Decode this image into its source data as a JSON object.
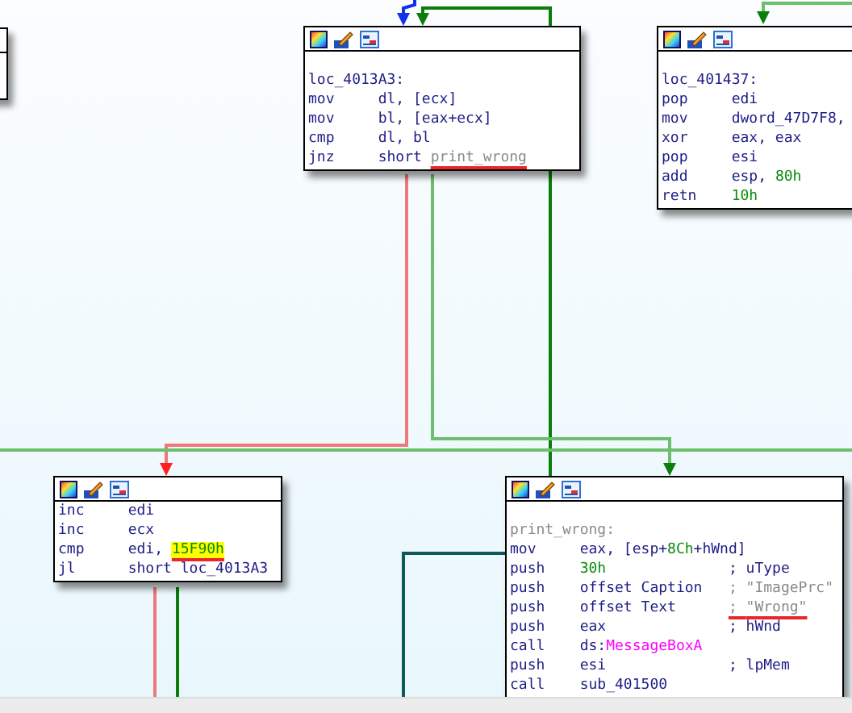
{
  "nodes": [
    {
      "lines": [
        {
          "kind": "blank"
        },
        {
          "kind": "label",
          "label": [
            {
              "text": "loc_4013A3:",
              "kind": "plain"
            }
          ]
        },
        {
          "kind": "code",
          "mnemonic": "mov",
          "operands": [
            {
              "text": "dl, [ecx]",
              "kind": "plain"
            }
          ]
        },
        {
          "kind": "code",
          "mnemonic": "mov",
          "operands": [
            {
              "text": "bl, [eax+ecx]",
              "kind": "plain"
            }
          ]
        },
        {
          "kind": "code",
          "mnemonic": "cmp",
          "operands": [
            {
              "text": "dl, bl",
              "kind": "plain"
            }
          ]
        },
        {
          "kind": "code",
          "mnemonic": "jnz",
          "operands": [
            {
              "text": "short ",
              "kind": "plain"
            },
            {
              "text": "print_wrong",
              "kind": "ref",
              "marked": true
            }
          ]
        }
      ]
    },
    {
      "lines": [
        {
          "kind": "blank"
        },
        {
          "kind": "label",
          "label": [
            {
              "text": "loc_401437:",
              "kind": "plain"
            }
          ]
        },
        {
          "kind": "code",
          "mnemonic": "pop",
          "operands": [
            {
              "text": "edi",
              "kind": "plain"
            }
          ]
        },
        {
          "kind": "code",
          "mnemonic": "mov",
          "operands": [
            {
              "text": "dword_47D7F8,",
              "kind": "plain"
            }
          ]
        },
        {
          "kind": "code",
          "mnemonic": "xor",
          "operands": [
            {
              "text": "eax, eax",
              "kind": "plain"
            }
          ]
        },
        {
          "kind": "code",
          "mnemonic": "pop",
          "operands": [
            {
              "text": "esi",
              "kind": "plain"
            }
          ]
        },
        {
          "kind": "code",
          "mnemonic": "add",
          "operands": [
            {
              "text": "esp, ",
              "kind": "plain"
            },
            {
              "text": "80h",
              "kind": "number"
            }
          ]
        },
        {
          "kind": "code",
          "mnemonic": "retn",
          "operands": [
            {
              "text": "10h",
              "kind": "number"
            }
          ]
        }
      ]
    },
    {
      "lines": [
        {
          "kind": "code",
          "mnemonic": "inc",
          "operands": [
            {
              "text": "edi",
              "kind": "plain"
            }
          ]
        },
        {
          "kind": "code",
          "mnemonic": "inc",
          "operands": [
            {
              "text": "ecx",
              "kind": "plain"
            }
          ]
        },
        {
          "kind": "code",
          "mnemonic": "cmp",
          "operands": [
            {
              "text": "edi, ",
              "kind": "plain"
            },
            {
              "text": "15F90h",
              "kind": "highlight",
              "marked": true
            }
          ]
        },
        {
          "kind": "code",
          "mnemonic": "jl",
          "operands": [
            {
              "text": "short loc_4013A3",
              "kind": "plain"
            }
          ]
        }
      ]
    },
    {
      "lines": [
        {
          "kind": "blank"
        },
        {
          "kind": "label",
          "label": [
            {
              "text": "print_wrong:",
              "kind": "ref"
            }
          ]
        },
        {
          "kind": "code",
          "mnemonic": "mov",
          "operands": [
            {
              "text": "eax, [esp+",
              "kind": "plain"
            },
            {
              "text": "8Ch",
              "kind": "number"
            },
            {
              "text": "+hWnd]",
              "kind": "plain"
            }
          ]
        },
        {
          "kind": "code",
          "mnemonic": "push",
          "operands": [
            {
              "text": "30h",
              "kind": "number"
            }
          ],
          "comment": [
            {
              "text": "; uType",
              "kind": "plain"
            }
          ]
        },
        {
          "kind": "code",
          "mnemonic": "push",
          "operands": [
            {
              "text": "offset Caption",
              "kind": "plain"
            }
          ],
          "comment": [
            {
              "text": "; ",
              "kind": "ref"
            },
            {
              "text": "\"ImagePrc\"",
              "kind": "ref"
            }
          ]
        },
        {
          "kind": "code",
          "mnemonic": "push",
          "operands": [
            {
              "text": "offset Text",
              "kind": "plain"
            }
          ],
          "comment": [
            {
              "text": "; ",
              "kind": "ref",
              "marked": true
            },
            {
              "text": "\"Wrong\"",
              "kind": "ref",
              "marked": true
            }
          ]
        },
        {
          "kind": "code",
          "mnemonic": "push",
          "operands": [
            {
              "text": "eax",
              "kind": "plain"
            }
          ],
          "comment": [
            {
              "text": "; hWnd",
              "kind": "plain"
            }
          ]
        },
        {
          "kind": "code",
          "mnemonic": "call",
          "operands": [
            {
              "text": "ds:",
              "kind": "plain"
            },
            {
              "text": "MessageBoxA",
              "kind": "import"
            }
          ]
        },
        {
          "kind": "code",
          "mnemonic": "push",
          "operands": [
            {
              "text": "esi",
              "kind": "plain"
            }
          ],
          "comment": [
            {
              "text": "; lpMem",
              "kind": "plain"
            }
          ]
        },
        {
          "kind": "code",
          "mnemonic": "call",
          "operands": [
            {
              "text": "sub_401500",
              "kind": "plain"
            }
          ]
        }
      ]
    }
  ]
}
